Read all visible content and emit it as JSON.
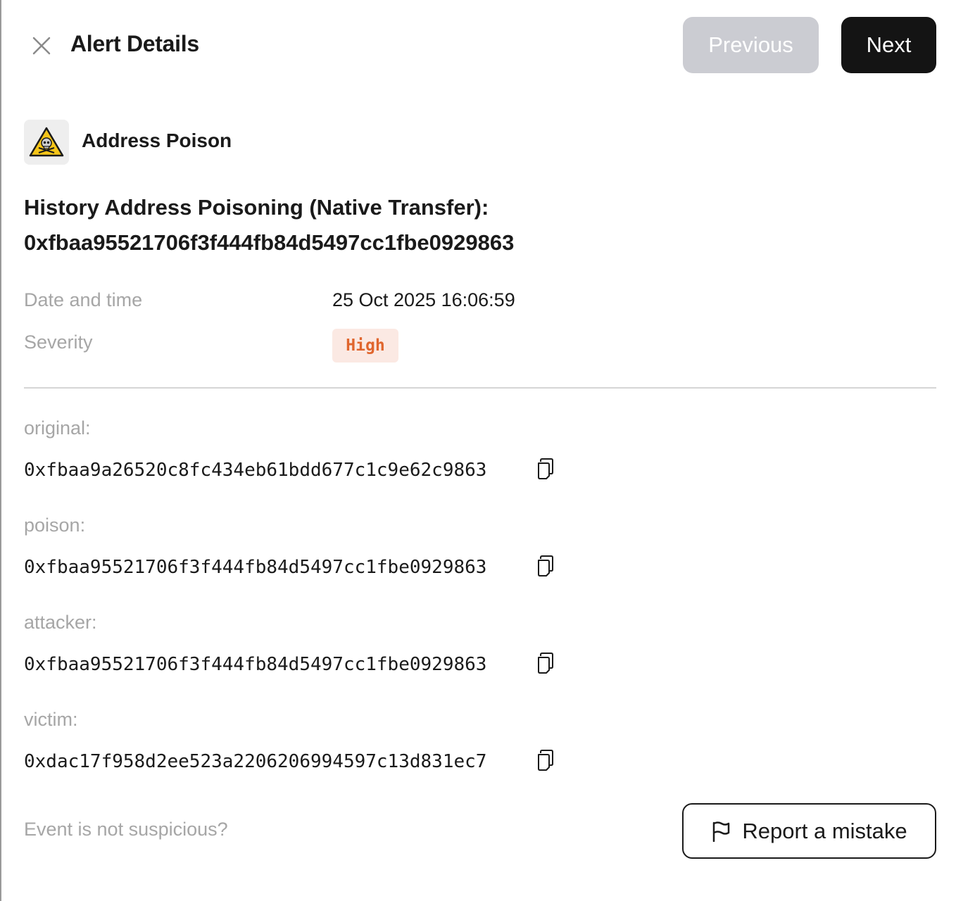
{
  "header": {
    "title": "Alert Details",
    "previous_label": "Previous",
    "next_label": "Next",
    "close_icon": "close-icon"
  },
  "alert": {
    "type_icon": "skull-warning-icon",
    "type_label": "Address Poison",
    "title_line1": "History Address Poisoning (Native Transfer):",
    "title_line2": "0xfbaa95521706f3f444fb84d5497cc1fbe0929863"
  },
  "meta": {
    "date_label": "Date and time",
    "date_value": "25 Oct 2025 16:06:59",
    "severity_label": "Severity",
    "severity_value": "High"
  },
  "fields": [
    {
      "label": "original:",
      "value": "0xfbaa9a26520c8fc434eb61bdd677c1c9e62c9863"
    },
    {
      "label": "poison:",
      "value": "0xfbaa95521706f3f444fb84d5497cc1fbe0929863"
    },
    {
      "label": "attacker:",
      "value": "0xfbaa95521706f3f444fb84d5497cc1fbe0929863"
    },
    {
      "label": "victim:",
      "value": "0xdac17f958d2ee523a2206206994597c13d831ec7"
    }
  ],
  "footer": {
    "question": "Event is not suspicious?",
    "report_label": "Report a mistake",
    "report_icon": "flag-icon"
  },
  "colors": {
    "severity_text": "#e0662e",
    "severity_bg": "#fbe9e3",
    "next_bg": "#141414",
    "previous_bg": "#cbccd2"
  }
}
